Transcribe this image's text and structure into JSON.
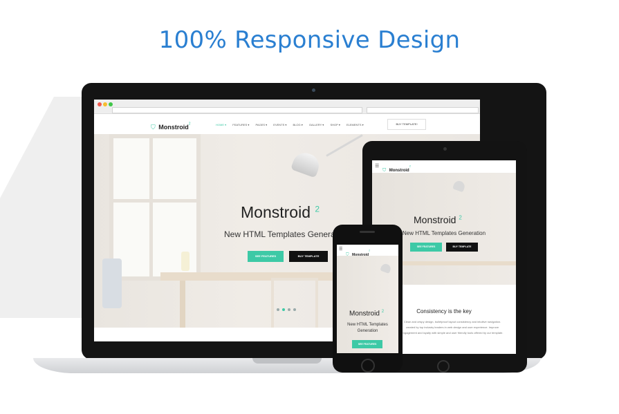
{
  "headline": "100% Responsive Design",
  "colors": {
    "accent": "#3dc9a6",
    "headline": "#2a7fd1",
    "dark": "#111111"
  },
  "site": {
    "logo_text": "Monstroid",
    "logo_sup": "2",
    "nav": [
      "HOME ▾",
      "FEATURES ▾",
      "PAGES ▾",
      "EVENTS ▾",
      "BLOG ▾",
      "GALLERY ▾",
      "SHOP ▾",
      "ELEMENTS ▾"
    ],
    "buy_template": "BUY TEMPLATE!",
    "hero_title": "Monstroid",
    "hero_sup": "2",
    "hero_subtitle": "New HTML Templates Generation",
    "see_features": "SEE FEATURES",
    "buy_template_btn": "BUY TEMPLATE"
  },
  "tablet": {
    "hero_subtitle": "New HTML Templates Generation",
    "section_title": "Consistency is the key",
    "section_lines": [
      "Clean and crispy design, bulletproof layout consistency and intuitive navigation.",
      "created by top industry leaders in web design and user experience. Improve",
      "engagement and loyalty with simple and user friendly tools offered by our template."
    ]
  },
  "phone": {
    "hero_subtitle_line1": "New HTML Templates",
    "hero_subtitle_line2": "Generation"
  }
}
